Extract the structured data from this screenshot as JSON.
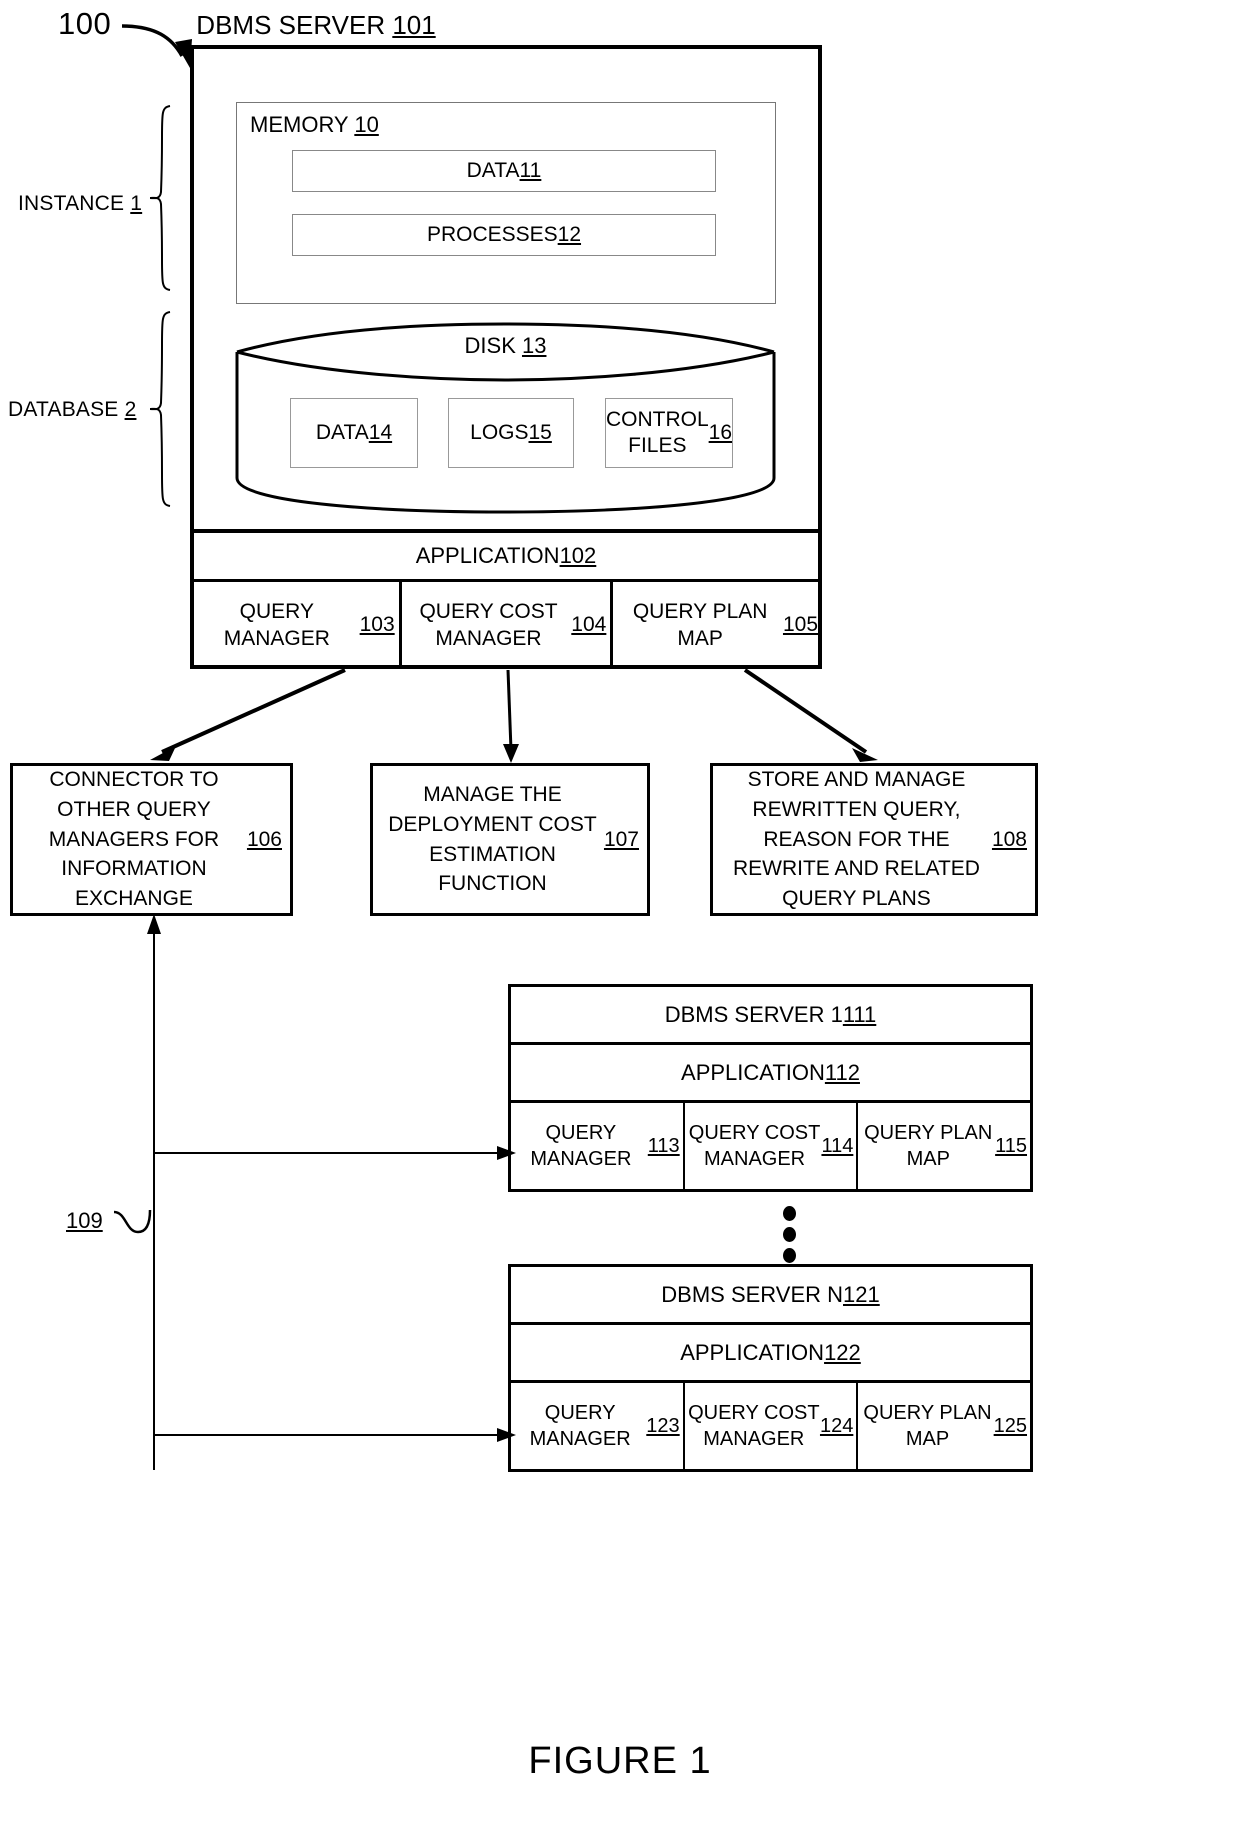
{
  "figure": {
    "ref_number": "100",
    "caption": "FIGURE 1"
  },
  "side_labels": {
    "instance": "INSTANCE 1",
    "database": "DATABASE 2"
  },
  "main_server": {
    "title": "DBMS SERVER 101",
    "memory": {
      "title": "MEMORY 10",
      "blocks": [
        {
          "label": "DATA 11"
        },
        {
          "label": "PROCESSES 12"
        }
      ]
    },
    "disk": {
      "title": "DISK 13",
      "blocks": [
        {
          "label": "DATA 14"
        },
        {
          "label": "LOGS 15"
        },
        {
          "label": "CONTROL FILES 16"
        }
      ]
    },
    "application": "APPLICATION 102",
    "managers": [
      {
        "label": "QUERY MANAGER 103"
      },
      {
        "label": "QUERY COST MANAGER 104"
      },
      {
        "label": "QUERY PLAN MAP 105"
      }
    ]
  },
  "actions": [
    {
      "label": "CONNECTOR TO OTHER QUERY MANAGERS FOR INFORMATION EXCHANGE 106"
    },
    {
      "label": "MANAGE THE DEPLOYMENT COST ESTIMATION FUNCTION 107"
    },
    {
      "label": "STORE AND MANAGE REWRITTEN QUERY, REASON FOR THE REWRITE AND RELATED QUERY PLANS 108"
    }
  ],
  "network": {
    "ref_number": "109",
    "servers": [
      {
        "title": "DBMS SERVER 1 111",
        "application": "APPLICATION 112",
        "columns": [
          {
            "label": "QUERY MANAGER 113"
          },
          {
            "label": "QUERY COST MANAGER 114"
          },
          {
            "label": "QUERY PLAN MAP 115"
          }
        ]
      },
      {
        "title": "DBMS SERVER N 121",
        "application": "APPLICATION 122",
        "columns": [
          {
            "label": "QUERY MANAGER 123"
          },
          {
            "label": "QUERY COST MANAGER 124"
          },
          {
            "label": "QUERY PLAN MAP 125"
          }
        ]
      }
    ]
  },
  "colors": {
    "stroke": "#000000",
    "inner_stroke": "#888888",
    "background": "#ffffff"
  }
}
